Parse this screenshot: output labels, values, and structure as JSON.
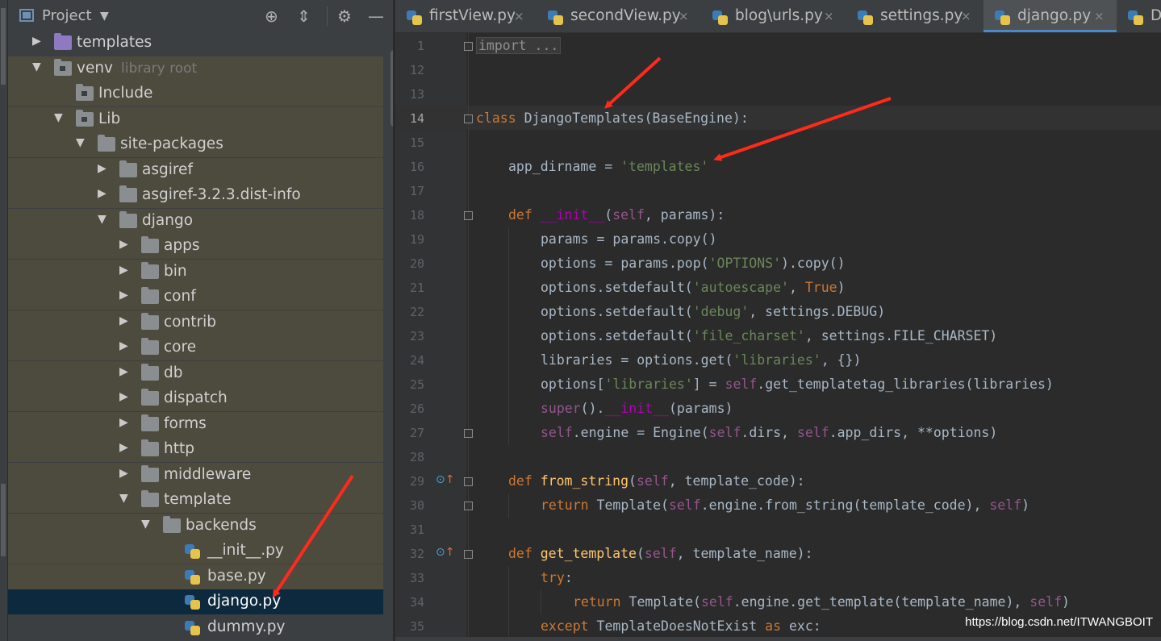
{
  "project_panel": {
    "title": "Project",
    "tree": [
      {
        "label": "templates",
        "sub": "",
        "kind": "folder-purple",
        "arrow": "▶",
        "indent": 1
      },
      {
        "label": "venv",
        "sub": "library root",
        "kind": "folder",
        "arrow": "▼",
        "indent": 1
      },
      {
        "label": "Include",
        "sub": "",
        "kind": "folder",
        "arrow": "",
        "indent": 2
      },
      {
        "label": "Lib",
        "sub": "",
        "kind": "folder",
        "arrow": "▼",
        "indent": 2
      },
      {
        "label": "site-packages",
        "sub": "",
        "kind": "folder",
        "arrow": "▼",
        "indent": 3
      },
      {
        "label": "asgiref",
        "sub": "",
        "kind": "folder",
        "arrow": "▶",
        "indent": 4
      },
      {
        "label": "asgiref-3.2.3.dist-info",
        "sub": "",
        "kind": "folder",
        "arrow": "▶",
        "indent": 4
      },
      {
        "label": "django",
        "sub": "",
        "kind": "folder",
        "arrow": "▼",
        "indent": 4
      },
      {
        "label": "apps",
        "sub": "",
        "kind": "folder",
        "arrow": "▶",
        "indent": 5
      },
      {
        "label": "bin",
        "sub": "",
        "kind": "folder",
        "arrow": "▶",
        "indent": 5
      },
      {
        "label": "conf",
        "sub": "",
        "kind": "folder",
        "arrow": "▶",
        "indent": 5
      },
      {
        "label": "contrib",
        "sub": "",
        "kind": "folder",
        "arrow": "▶",
        "indent": 5
      },
      {
        "label": "core",
        "sub": "",
        "kind": "folder",
        "arrow": "▶",
        "indent": 5
      },
      {
        "label": "db",
        "sub": "",
        "kind": "folder",
        "arrow": "▶",
        "indent": 5
      },
      {
        "label": "dispatch",
        "sub": "",
        "kind": "folder",
        "arrow": "▶",
        "indent": 5
      },
      {
        "label": "forms",
        "sub": "",
        "kind": "folder",
        "arrow": "▶",
        "indent": 5
      },
      {
        "label": "http",
        "sub": "",
        "kind": "folder",
        "arrow": "▶",
        "indent": 5
      },
      {
        "label": "middleware",
        "sub": "",
        "kind": "folder",
        "arrow": "▶",
        "indent": 5
      },
      {
        "label": "template",
        "sub": "",
        "kind": "folder",
        "arrow": "▼",
        "indent": 5
      },
      {
        "label": "backends",
        "sub": "",
        "kind": "folder",
        "arrow": "▼",
        "indent": 6
      },
      {
        "label": "__init__.py",
        "sub": "",
        "kind": "py",
        "arrow": "",
        "indent": 7
      },
      {
        "label": "base.py",
        "sub": "",
        "kind": "py",
        "arrow": "",
        "indent": 7
      },
      {
        "label": "django.py",
        "sub": "",
        "kind": "py",
        "arrow": "",
        "indent": 7,
        "selected": true
      },
      {
        "label": "dummy.py",
        "sub": "",
        "kind": "py",
        "arrow": "",
        "indent": 7
      }
    ]
  },
  "tabs": [
    {
      "label": "firstView.py",
      "close": "×"
    },
    {
      "label": "secondView.py",
      "close": "×"
    },
    {
      "label": "blog\\urls.py",
      "close": "×"
    },
    {
      "label": "settings.py",
      "close": "×"
    },
    {
      "label": "django.py",
      "close": "×",
      "active": true
    },
    {
      "label": "Do",
      "close": ""
    }
  ],
  "editor": {
    "current_line": "14",
    "lines": [
      {
        "n": "1",
        "indent": 0,
        "tokens": [
          {
            "t": "import ...",
            "c": "folded"
          }
        ]
      },
      {
        "n": "12",
        "indent": 0,
        "tokens": []
      },
      {
        "n": "13",
        "indent": 0,
        "tokens": []
      },
      {
        "n": "14",
        "indent": 0,
        "tokens": [
          {
            "t": "class ",
            "c": "kw"
          },
          {
            "t": "DjangoTemplates",
            "c": ""
          },
          {
            "t": "(BaseEngine):",
            "c": ""
          }
        ]
      },
      {
        "n": "15",
        "indent": 0,
        "tokens": []
      },
      {
        "n": "16",
        "indent": 1,
        "tokens": [
          {
            "t": "app_dirname = ",
            "c": ""
          },
          {
            "t": "'templates'",
            "c": "str"
          }
        ]
      },
      {
        "n": "17",
        "indent": 0,
        "tokens": []
      },
      {
        "n": "18",
        "indent": 1,
        "tokens": [
          {
            "t": "def ",
            "c": "kw"
          },
          {
            "t": "__init__",
            "c": "magic"
          },
          {
            "t": "(",
            "c": ""
          },
          {
            "t": "self",
            "c": "self"
          },
          {
            "t": ", params):",
            "c": ""
          }
        ]
      },
      {
        "n": "19",
        "indent": 2,
        "tokens": [
          {
            "t": "params = params.copy()",
            "c": ""
          }
        ]
      },
      {
        "n": "20",
        "indent": 2,
        "tokens": [
          {
            "t": "options = params.pop(",
            "c": ""
          },
          {
            "t": "'OPTIONS'",
            "c": "str"
          },
          {
            "t": ").copy()",
            "c": ""
          }
        ]
      },
      {
        "n": "21",
        "indent": 2,
        "tokens": [
          {
            "t": "options.setdefault(",
            "c": ""
          },
          {
            "t": "'autoescape'",
            "c": "str"
          },
          {
            "t": ", ",
            "c": ""
          },
          {
            "t": "True",
            "c": "kw"
          },
          {
            "t": ")",
            "c": ""
          }
        ]
      },
      {
        "n": "22",
        "indent": 2,
        "tokens": [
          {
            "t": "options.setdefault(",
            "c": ""
          },
          {
            "t": "'debug'",
            "c": "str"
          },
          {
            "t": ", settings.DEBUG)",
            "c": ""
          }
        ]
      },
      {
        "n": "23",
        "indent": 2,
        "tokens": [
          {
            "t": "options.setdefault(",
            "c": ""
          },
          {
            "t": "'file_charset'",
            "c": "str"
          },
          {
            "t": ", settings.FILE_CHARSET)",
            "c": ""
          }
        ]
      },
      {
        "n": "24",
        "indent": 2,
        "tokens": [
          {
            "t": "libraries = options.get(",
            "c": ""
          },
          {
            "t": "'libraries'",
            "c": "str"
          },
          {
            "t": ", {})",
            "c": ""
          }
        ]
      },
      {
        "n": "25",
        "indent": 2,
        "tokens": [
          {
            "t": "options[",
            "c": ""
          },
          {
            "t": "'libraries'",
            "c": "str"
          },
          {
            "t": "] = ",
            "c": ""
          },
          {
            "t": "self",
            "c": "self"
          },
          {
            "t": ".get_templatetag_libraries(libraries)",
            "c": ""
          }
        ]
      },
      {
        "n": "26",
        "indent": 2,
        "tokens": [
          {
            "t": "super",
            "c": "self"
          },
          {
            "t": "().",
            "c": ""
          },
          {
            "t": "__init__",
            "c": "magic"
          },
          {
            "t": "(params)",
            "c": ""
          }
        ]
      },
      {
        "n": "27",
        "indent": 2,
        "tokens": [
          {
            "t": "self",
            "c": "self"
          },
          {
            "t": ".engine = Engine(",
            "c": ""
          },
          {
            "t": "self",
            "c": "self"
          },
          {
            "t": ".dirs, ",
            "c": ""
          },
          {
            "t": "self",
            "c": "self"
          },
          {
            "t": ".app_dirs, **options)",
            "c": ""
          }
        ]
      },
      {
        "n": "28",
        "indent": 0,
        "tokens": []
      },
      {
        "n": "29",
        "indent": 1,
        "override": true,
        "tokens": [
          {
            "t": "def ",
            "c": "kw"
          },
          {
            "t": "from_string",
            "c": "fn"
          },
          {
            "t": "(",
            "c": ""
          },
          {
            "t": "self",
            "c": "self"
          },
          {
            "t": ", template_code):",
            "c": ""
          }
        ]
      },
      {
        "n": "30",
        "indent": 2,
        "tokens": [
          {
            "t": "return ",
            "c": "kw"
          },
          {
            "t": "Template(",
            "c": ""
          },
          {
            "t": "self",
            "c": "self"
          },
          {
            "t": ".engine.from_string(template_code), ",
            "c": ""
          },
          {
            "t": "self",
            "c": "self"
          },
          {
            "t": ")",
            "c": ""
          }
        ]
      },
      {
        "n": "31",
        "indent": 0,
        "tokens": []
      },
      {
        "n": "32",
        "indent": 1,
        "override": true,
        "tokens": [
          {
            "t": "def ",
            "c": "kw"
          },
          {
            "t": "get_template",
            "c": "fn"
          },
          {
            "t": "(",
            "c": ""
          },
          {
            "t": "self",
            "c": "self"
          },
          {
            "t": ", template_name):",
            "c": ""
          }
        ]
      },
      {
        "n": "33",
        "indent": 2,
        "tokens": [
          {
            "t": "try",
            "c": "kw"
          },
          {
            "t": ":",
            "c": ""
          }
        ]
      },
      {
        "n": "34",
        "indent": 3,
        "tokens": [
          {
            "t": "return ",
            "c": "kw"
          },
          {
            "t": "Template(",
            "c": ""
          },
          {
            "t": "self",
            "c": "self"
          },
          {
            "t": ".engine.get_template(template_name), ",
            "c": ""
          },
          {
            "t": "self",
            "c": "self"
          },
          {
            "t": ")",
            "c": ""
          }
        ]
      },
      {
        "n": "35",
        "indent": 2,
        "tokens": [
          {
            "t": "except ",
            "c": "kw"
          },
          {
            "t": "TemplateDoesNotExist ",
            "c": ""
          },
          {
            "t": "as ",
            "c": "kw"
          },
          {
            "t": "exc:",
            "c": ""
          }
        ]
      }
    ]
  },
  "watermark": "https://blog.csdn.net/ITWANGBOIT",
  "colors": {
    "keyword": "#cc7832",
    "string": "#6a8759",
    "function": "#ffc66d",
    "self": "#94558d",
    "annotation_arrow": "#ff2a1a"
  }
}
